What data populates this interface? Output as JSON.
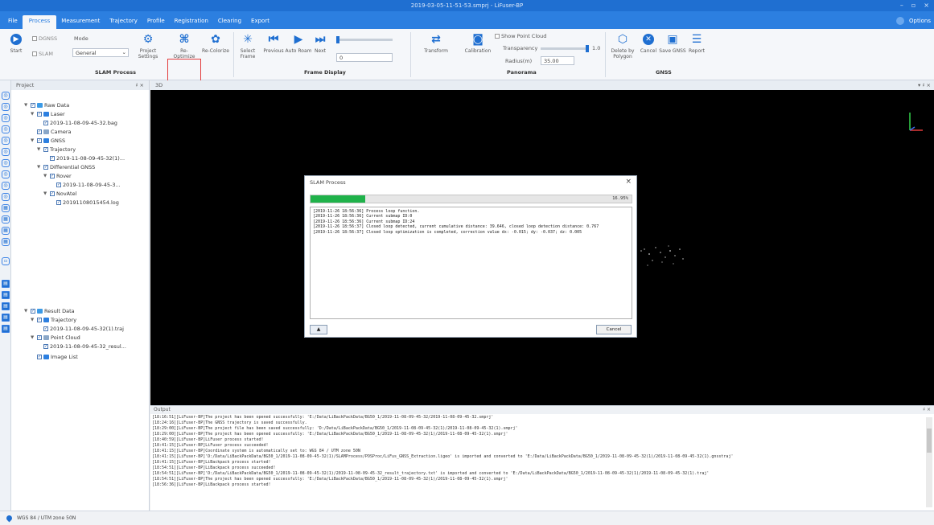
{
  "window": {
    "title": "2019-03-05-11-51-53.smprj - LiFuser-BP"
  },
  "menu": {
    "items": [
      "File",
      "Process",
      "Measurement",
      "Trajectory",
      "Profile",
      "Registration",
      "Clearing",
      "Export"
    ],
    "active": "Process",
    "options": "Options"
  },
  "ribbon": {
    "start": "Start",
    "dgnss": "DGNSS",
    "slam": "SLAM",
    "mode_label": "Mode",
    "mode_value": "General",
    "project_settings": "Project Settings",
    "reoptimize": "Re-Optimize",
    "recolorize": "Re-Colorize",
    "select_frame": "Select Frame",
    "previous": "Previous",
    "auto_roam": "Auto Roam",
    "next": "Next",
    "frame_value": "0",
    "transform": "Transform",
    "calibration": "Calibration",
    "show_point_cloud": "Show Point Cloud",
    "transparency": "Transparency",
    "transparency_value": "1.0",
    "radius_label": "Radius(m)",
    "radius_value": "35.00",
    "delete_by_polygon": "Delete by Polygon",
    "cancel": "Cancel",
    "save_gnss": "Save GNSS",
    "report": "Report",
    "group_slam": "SLAM Process",
    "group_frame": "Frame Display",
    "group_panorama": "Panorama",
    "group_gnss": "GNSS"
  },
  "project": {
    "title": "Project",
    "raw_data": "Raw Data",
    "laser": "Laser",
    "laser_file": "2019-11-08-09-45-32.bag",
    "camera": "Camera",
    "gnss": "GNSS",
    "trajectory": "Trajectory",
    "trajectory_file": "2019-11-08-09-45-32(1)...",
    "differential_gnss": "Differential GNSS",
    "rover": "Rover",
    "rover_file": "2019-11-08-09-45-3...",
    "novatel": "NovAtel",
    "novatel_file": "20191108015454.log",
    "result_data": "Result Data",
    "result_trajectory": "Trajectory",
    "result_trajectory_file": "2019-11-08-09-45-32(1).traj",
    "point_cloud": "Point Cloud",
    "point_cloud_file": "2019-11-08-09-45-32_resul...",
    "image_list": "Image List"
  },
  "viewport": {
    "tab": "3D"
  },
  "dialog": {
    "title": "SLAM Process",
    "progress_pct": "16.95%",
    "progress": 0.17,
    "log": [
      "[2019-11-26 18:56:36] Process loop function.",
      "[2019-11-26 18:56:36] Current submap ID:0",
      "[2019-11-26 18:56:36] Current submap ID:24",
      "[2019-11-26 18:56:37] Closed loop detected, current cumulative distance: 39.646, closed loop detection distance: 0.767",
      "[2019-11-26 18:56:37] Closed loop optimization is completed, correction value dx: -0.015; dy: -0.037; dz: 0.005"
    ],
    "cancel": "Cancel"
  },
  "output": {
    "title": "Output",
    "lines": [
      "[18:16:51][LiFuser-BP]The project has been opened successfully: 'E:/Data/LiBackPackData/BG50_1/2019-11-08-09-45-32/2019-11-08-09-45-32.smprj'",
      "[18:24:16][LiFuser-BP]The GNSS trajectory is saved successfully.",
      "[18:29:00][LiFuser-BP]The project file has been saved successfully: 'D:/Data/LiBackPackData/BG50_1/2019-11-08-09-45-32(1)/2019-11-08-09-45-32(1).smprj'",
      "[18:29:00][LiFuser-BP]The project has been opened successfully: 'E:/Data/LiBackPackData/BG50_1/2019-11-08-09-45-32(1)/2019-11-08-09-45-32(1).smprj'",
      "[18:40:59][LiFuser-BP]LiFuser process started!",
      "[18:41:15][LiFuser-BP]LiFuser process succeeded!",
      "[18:41:15][LiFuser-BP]Coordinate system is automatically set to: WGS 84 / UTM zone 50N",
      "[18:41:15][LiFuser-BP]'D:/Data/LiBackPackData/BG50_1/2019-11-08-09-45-32(1)/SLAMProcess/POSProc/LiFus_GNSS_Extraction.ligeo' is imported and converted to 'E:/Data/LiBackPackData/BG50_1/2019-11-08-09-45-32(1)/2019-11-08-09-45-32(1).gnsstraj'",
      "[18:41:15][LiFuser-BP]LiBackpack process started!",
      "[18:54:51][LiFuser-BP]LiBackpack process succeeded!",
      "[18:54:51][LiFuser-BP]'D:/Data/LiBackPackData/BG50_1/2019-11-08-09-45-32(1)/2019-11-08-09-45-32_result_trajectory.txt' is imported and converted to 'E:/Data/LiBackPackData/BG50_1/2019-11-08-09-45-32(1)/2019-11-08-09-45-32(1).traj'",
      "[18:54:51][LiFuser-BP]The project has been opened successfully: 'E:/Data/LiBackPackData/BG50_1/2019-11-08-09-45-32(1)/2019-11-08-09-45-32(1).smprj'",
      "[18:56:36][LiFuser-BP]LiBackpack process started!"
    ]
  },
  "status": {
    "crs": "WGS 84 / UTM zone 50N"
  },
  "colors": {
    "accent": "#2c7fe0",
    "progress": "#1fb24a",
    "highlight": "#e23b3b"
  }
}
